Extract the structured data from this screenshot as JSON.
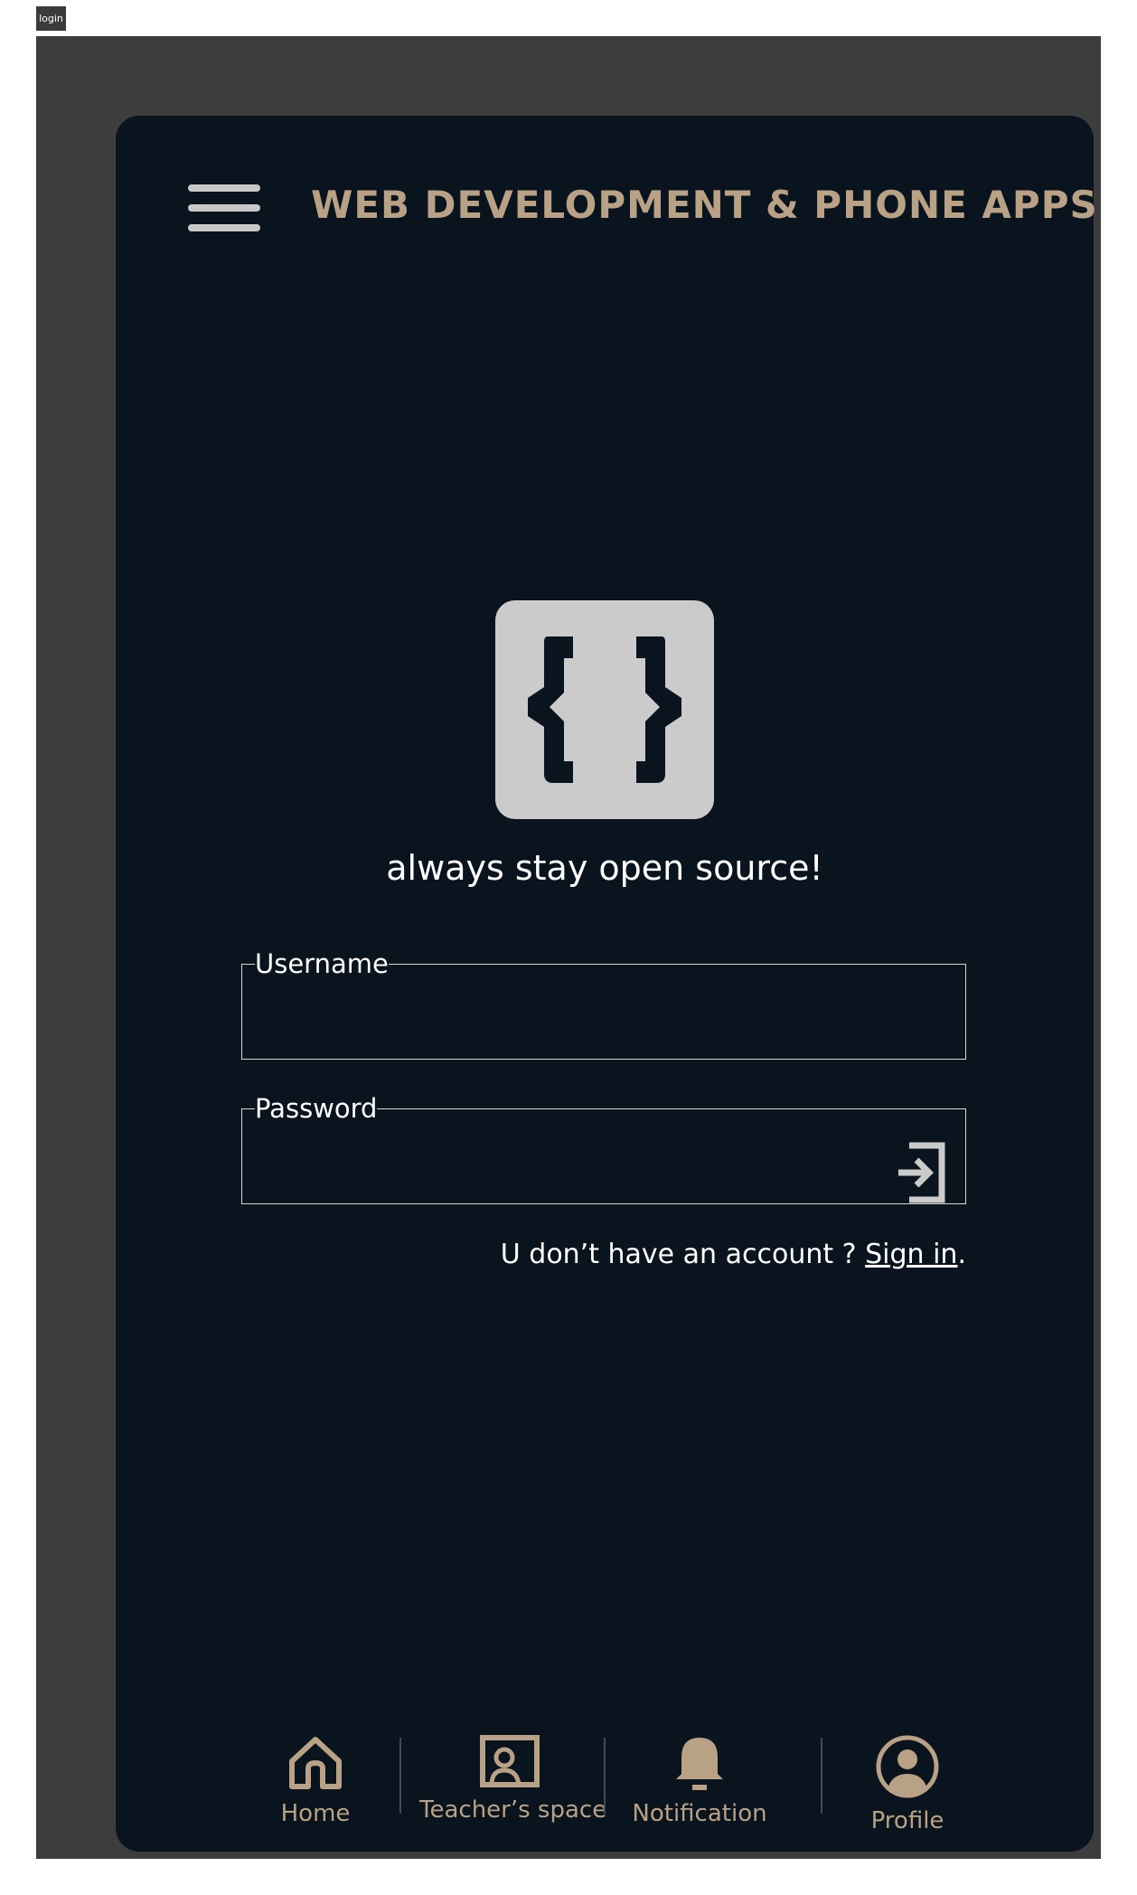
{
  "window": {
    "frame_tag": "login"
  },
  "header": {
    "menu_icon": "hamburger-icon",
    "title": "WEB DEVELOPMENT & PHONE APPS"
  },
  "logo": {
    "icon": "curly-braces-icon"
  },
  "tagline": "always stay open source!",
  "form": {
    "username": {
      "label": "Username",
      "value": ""
    },
    "password": {
      "label": "Password",
      "value": "",
      "action_icon": "login-icon"
    }
  },
  "signup": {
    "prompt": "U don’t have an account ? ",
    "link": "Sign in",
    "suffix": "."
  },
  "nav": {
    "items": [
      {
        "label": "Home",
        "icon": "home-icon"
      },
      {
        "label": "Teacher’s space",
        "icon": "teacher-board-icon"
      },
      {
        "label": "Notification",
        "icon": "bell-icon"
      },
      {
        "label": "Profile",
        "icon": "profile-icon"
      }
    ]
  },
  "colors": {
    "frame": "#3d3d3d",
    "background": "#0a141e",
    "accent": "#b8a184",
    "text": "#ffffff",
    "logo_bg": "#cbcbcb"
  }
}
